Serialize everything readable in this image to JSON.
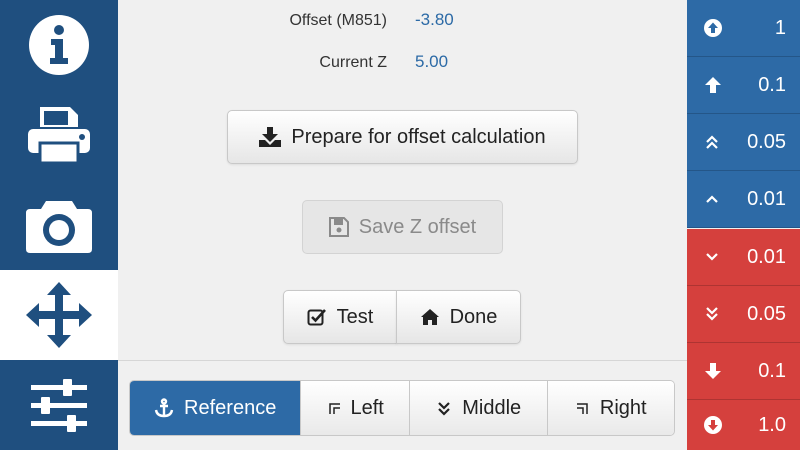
{
  "sidebar": {
    "tabs": [
      {
        "name": "info",
        "icon": "info-icon"
      },
      {
        "name": "print",
        "icon": "printer-icon"
      },
      {
        "name": "camera",
        "icon": "camera-icon"
      },
      {
        "name": "move",
        "icon": "move-arrows-icon",
        "active": true
      },
      {
        "name": "settings",
        "icon": "sliders-icon"
      }
    ]
  },
  "info": {
    "offset_label": "Offset (M851)",
    "offset_value": "-3.80",
    "current_z_label": "Current Z",
    "current_z_value": "5.00"
  },
  "actions": {
    "prepare_label": "Prepare for offset calculation",
    "save_label": "Save Z offset",
    "test_label": "Test",
    "done_label": "Done"
  },
  "positions": {
    "items": [
      "Reference",
      "Left",
      "Middle",
      "Right"
    ],
    "selected": "Reference"
  },
  "jog": {
    "up": [
      "1",
      "0.1",
      "0.05",
      "0.01"
    ],
    "down": [
      "0.01",
      "0.05",
      "0.1",
      "1.0"
    ]
  },
  "colors": {
    "sidebar": "#1f4f7f",
    "accent": "#2d6aa6",
    "down": "#d5403d",
    "value": "#2c6aa6"
  }
}
